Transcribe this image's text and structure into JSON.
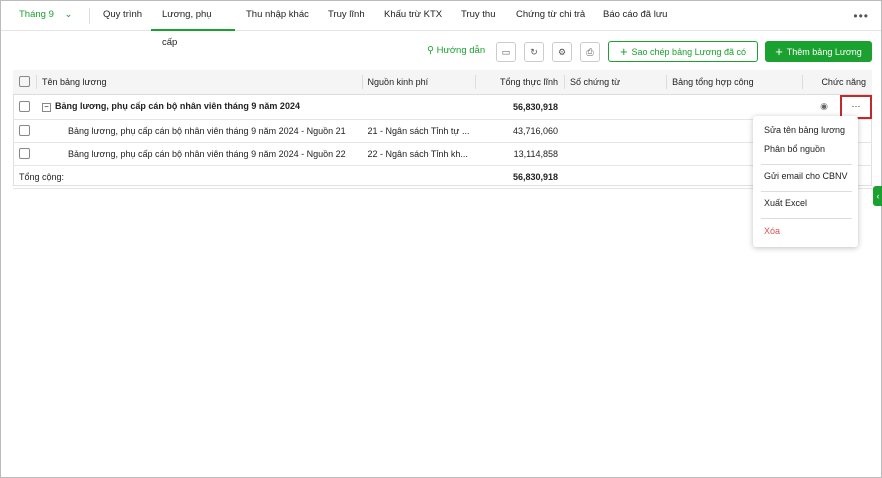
{
  "tabs": {
    "month": "Tháng 9",
    "items": [
      "Quy trình",
      "Lương, phụ cấp",
      "Thu nhập khác",
      "Truy lĩnh",
      "Khấu trừ KTX",
      "Truy thu",
      "Chứng từ chi trả",
      "Báo cáo đã lưu"
    ],
    "more": "•••"
  },
  "toolbar": {
    "guide": "Hướng dẫn",
    "copy": "Sao chép bảng Lương đã có",
    "add": "Thêm bảng Lương"
  },
  "table": {
    "headers": [
      "Tên bảng lương",
      "Nguồn kinh phí",
      "Tổng thực lĩnh",
      "Số chứng từ",
      "Bảng tổng hợp công",
      "Chức năng"
    ],
    "group": {
      "name": "Bảng lương, phụ cấp cán bộ nhân viên tháng 9 năm 2024",
      "total": "56,830,918"
    },
    "rows": [
      {
        "name": "Bảng lương, phụ cấp cán bộ nhân viên tháng 9 năm 2024 - Nguồn 21",
        "source": "21 - Ngân sách Tỉnh tự ...",
        "total": "43,716,060"
      },
      {
        "name": "Bảng lương, phụ cấp cán bộ nhân viên tháng 9 năm 2024 - Nguồn 22",
        "source": "22 - Ngân sách Tỉnh kh...",
        "total": "13,114,858"
      }
    ],
    "footer": {
      "label": "Tổng cộng:",
      "total": "56,830,918"
    }
  },
  "menu": [
    "Sửa tên bảng lương",
    "Phân bổ nguồn",
    "Gửi email cho CBNV",
    "Xuất Excel",
    "Xóa"
  ],
  "colors": {
    "accent": "#1aa12f",
    "danger": "#d9534f"
  }
}
